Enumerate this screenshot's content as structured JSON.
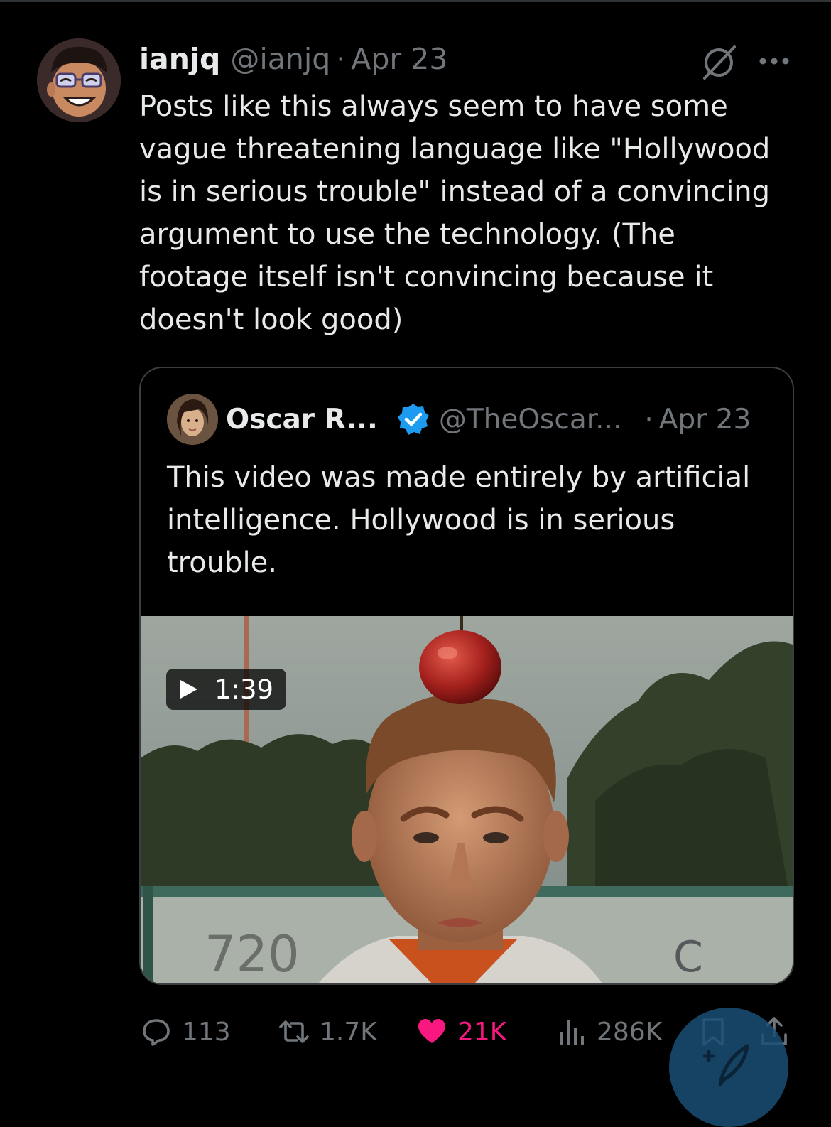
{
  "post": {
    "author_name": "ianjq",
    "author_handle": "@ianjq",
    "separator": "·",
    "date": "Apr 23",
    "text": "Posts like this always seem to have some\nvague threatening language like \"Hollywood\nis in serious trouble\" instead of a convincing\nargument to use the technology. (The\nfootage itself isn't convincing because it\ndoesn't look good)"
  },
  "quoted_post": {
    "author_name": "Oscar R...",
    "author_handle": "@TheOscar...",
    "separator": "·",
    "date": "Apr 23",
    "verified": true,
    "text": "This video was made entirely by artificial\nintelligence. Hollywood is in serious\ntrouble.",
    "video_duration": "1:39"
  },
  "actions": {
    "replies": "113",
    "reposts": "1.7K",
    "likes": "21K",
    "views": "286K"
  },
  "colors": {
    "background": "#000000",
    "text": "#e7e9ea",
    "secondary": "#71767b",
    "like": "#f91880",
    "verified": "#1d9bf0"
  },
  "icons": {
    "header": [
      "null-icon",
      "more-icon"
    ],
    "actions": [
      "reply-icon",
      "repost-icon",
      "heart-icon",
      "views-icon",
      "bookmark-icon",
      "share-icon"
    ]
  }
}
